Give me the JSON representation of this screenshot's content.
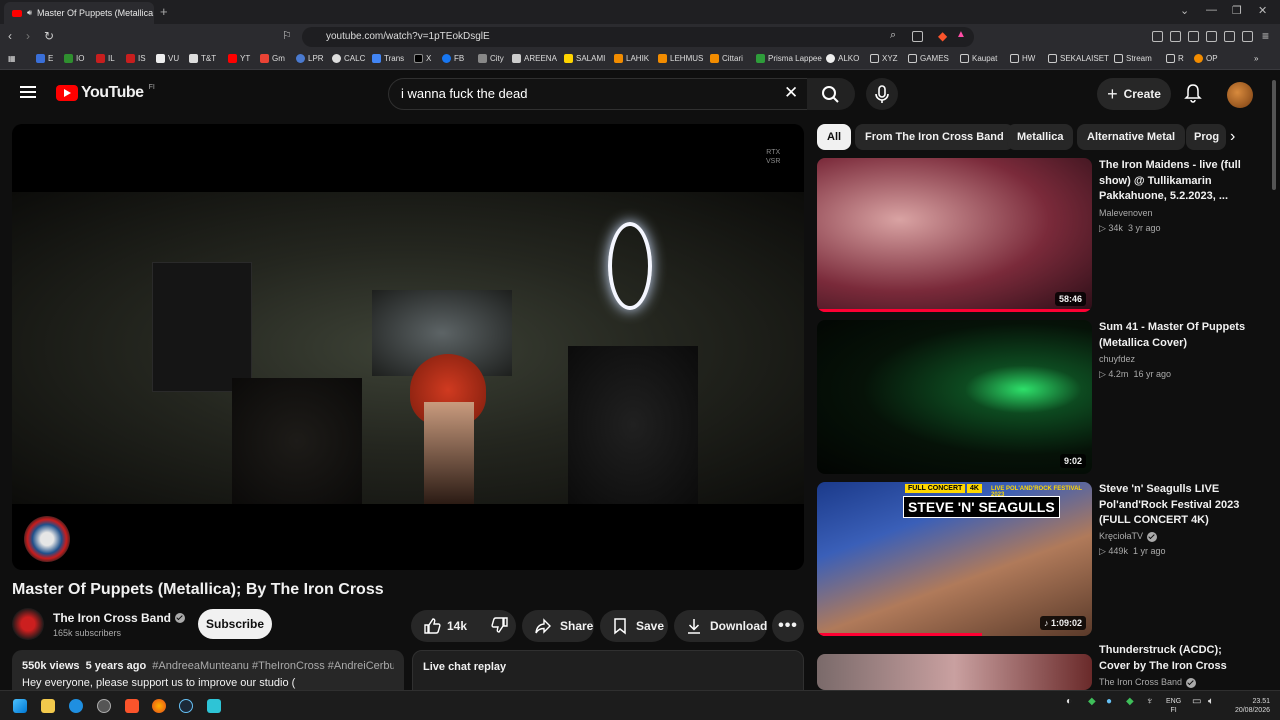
{
  "browser": {
    "tab_title": "Master Of Puppets (Metallica",
    "url": "youtube.com/watch?v=1pTEokDsglE",
    "bookmarks": [
      "E",
      "IO",
      "IL",
      "IS",
      "VU",
      "T&T",
      "YT",
      "Gm",
      "LPR",
      "CALC",
      "Trans",
      "X",
      "FB",
      "City",
      "AREENA",
      "SALAMI",
      "LAHIK",
      "LEHMUS",
      "Cittari",
      "Prisma Lappee",
      "ALKO",
      "XYZ",
      "GAMES",
      "Kaupat",
      "HW",
      "SEKALAISET",
      "Stream",
      "R",
      "OP"
    ]
  },
  "youtube": {
    "logo_text": "YouTube",
    "region": "FI",
    "search_value": "i wanna fuck the dead",
    "create_label": "Create"
  },
  "player": {
    "overlay_tag": [
      "RTX",
      "VSR"
    ]
  },
  "video": {
    "title": "Master Of Puppets (Metallica); By The Iron Cross",
    "channel": "The Iron Cross Band",
    "subscribers": "165k subscribers",
    "subscribe_label": "Subscribe",
    "likes": "14k",
    "share_label": "Share",
    "save_label": "Save",
    "download_label": "Download",
    "views": "550k views",
    "age": "5 years ago",
    "hashtags": "#AndreeaMunteanu #TheIronCross #AndreiCerbu",
    "description": "Hey everyone, please support us to improve our studio (",
    "live_chat": "Live chat replay"
  },
  "chips": [
    "All",
    "From The Iron Cross Band",
    "Metallica",
    "Alternative Metal",
    "Prog"
  ],
  "recommendations": [
    {
      "title": "The Iron Maidens - live (full show) @ Tullikamarin Pakkahuone, 5.2.2023, ...",
      "channel": "Malevenoven",
      "views": "34k",
      "age": "3 yr ago",
      "duration": "58:46",
      "progress": 1.0,
      "verified": false
    },
    {
      "title": "Sum 41 - Master Of Puppets (Metallica Cover)",
      "channel": "chuyfdez",
      "views": "4.2m",
      "age": "16 yr ago",
      "duration": "9:02",
      "progress": 0,
      "verified": false
    },
    {
      "title": "Steve 'n' Seagulls LIVE Pol'and'Rock Festival 2023 (FULL CONCERT 4K)",
      "channel": "KręciołaTV",
      "views": "449k",
      "age": "1 yr ago",
      "duration": "1:09:02",
      "progress": 0.6,
      "verified": true
    },
    {
      "title": "Thunderstruck (ACDC); Cover by The Iron Cross",
      "channel": "The Iron Cross Band",
      "views": "",
      "age": "",
      "duration": "",
      "progress": 0,
      "verified": true
    }
  ],
  "thumb3_text": {
    "badge": "FULL CONCERT",
    "k4": "4K",
    "festival": "LIVE POL'AND'ROCK FESTIVAL 2023",
    "name": "STEVE 'N' SEAGULLS"
  },
  "taskbar": {
    "lang": "ENG",
    "region": "FI",
    "time": "23.51",
    "date": "20/08/2026"
  },
  "colors": {
    "bg": "#0f0f0f",
    "accent": "#ff0000",
    "progress": "#ff0033"
  }
}
